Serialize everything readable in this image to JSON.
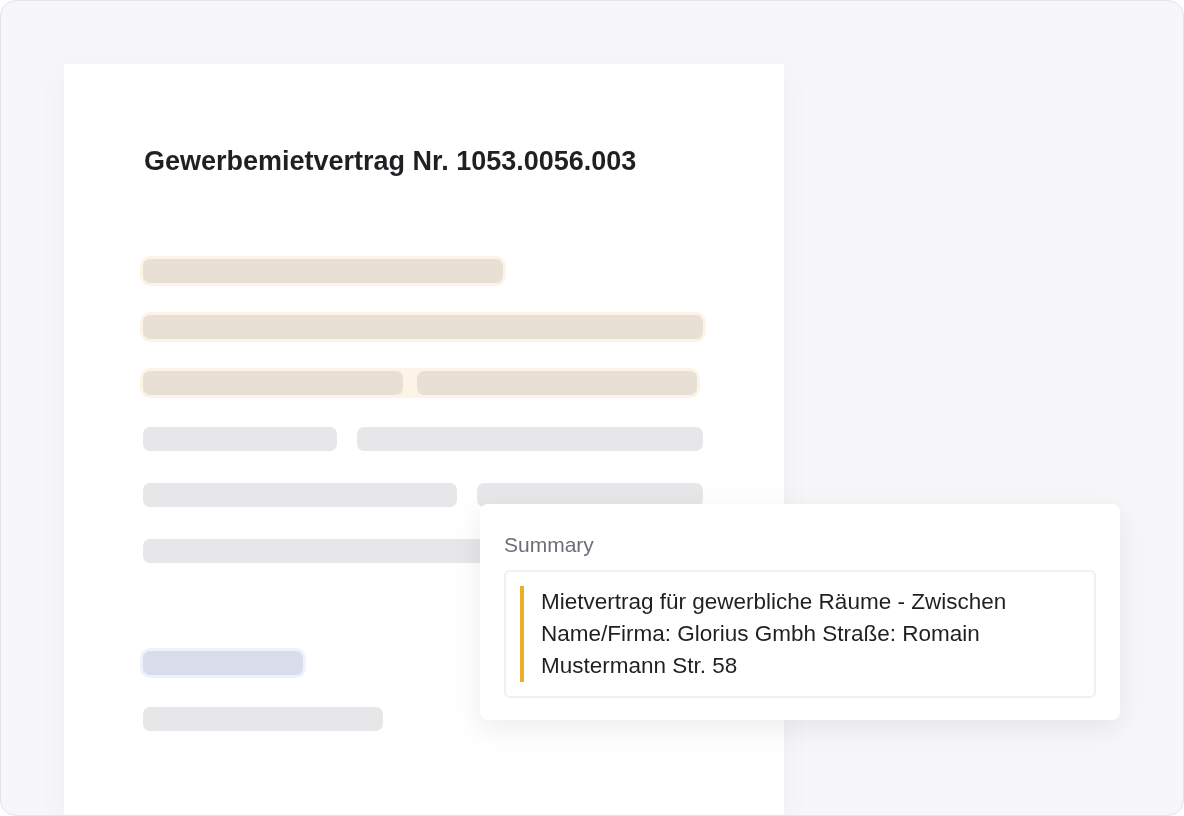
{
  "document": {
    "title": "Gewerbemietvertrag Nr. 1053.0056.003",
    "body_lines": [
      {
        "kind": "highlight"
      },
      {
        "kind": "highlight"
      },
      {
        "kind": "highlight"
      },
      {
        "kind": "plain"
      },
      {
        "kind": "plain"
      },
      {
        "kind": "plain"
      }
    ],
    "footer_lines": [
      {
        "kind": "focus"
      },
      {
        "kind": "plain"
      }
    ]
  },
  "summary_card": {
    "label": "Summary",
    "text": "Mietvertrag für gewerbliche Räume - Zwischen Name/Firma: Glorius Gmbh Straße: Romain Mustermann Str. 58"
  }
}
